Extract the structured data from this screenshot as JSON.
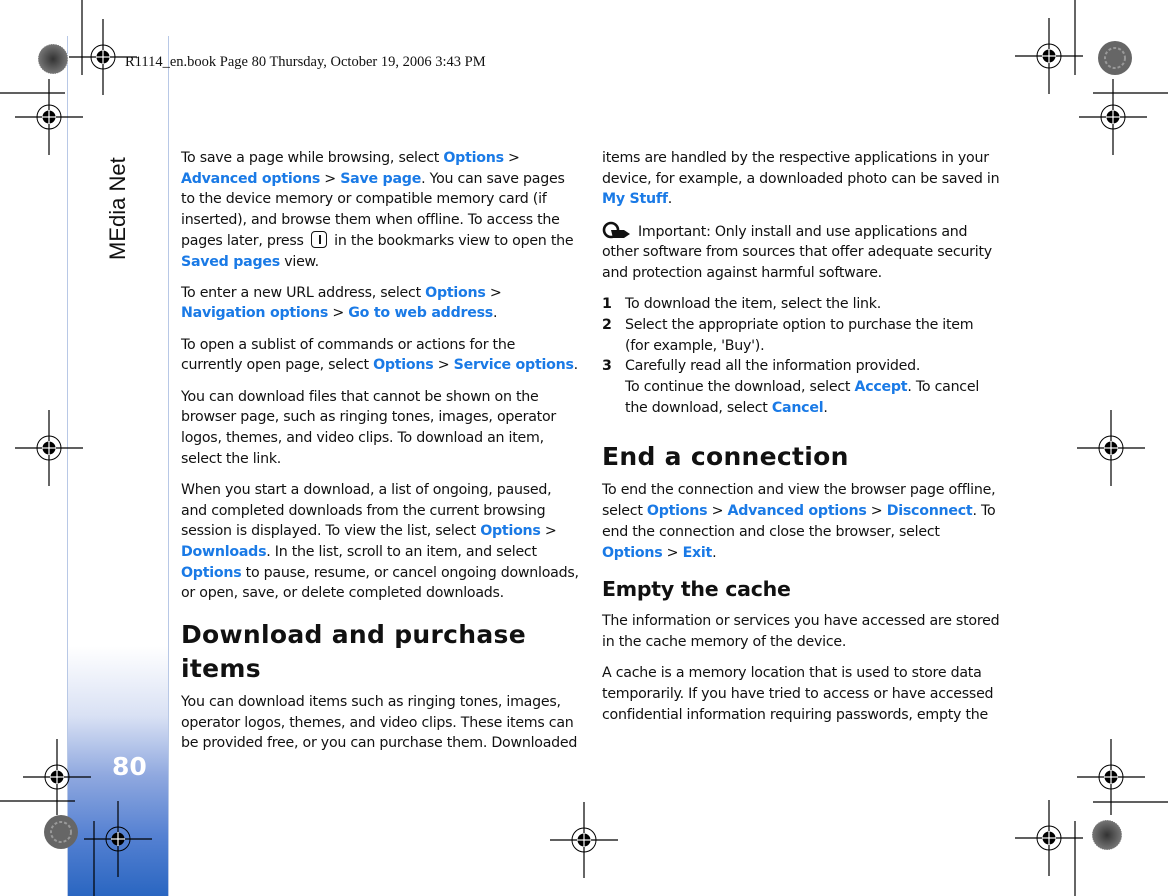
{
  "header": {
    "print_info": "R1114_en.book  Page 80  Thursday, October 19, 2006  3:43 PM"
  },
  "side_tab": {
    "section_title": "MEdia Net",
    "page_number": "80",
    "gradient_color": "#2a66c1"
  },
  "colors": {
    "link": "#1a7ae6",
    "text": "#111111"
  },
  "left_column": {
    "p1": {
      "t1": "To save a page while browsing, select ",
      "l1": "Options",
      "t2": " > ",
      "l2": "Advanced options",
      "t3": " > ",
      "l3": "Save page",
      "t4": ". You can save pages to the device memory or compatible memory card (if inserted), and browse them when offline. To access the pages later, press ",
      "key_icon": "scroll-key-icon",
      "t5": " in the bookmarks view to open the ",
      "l4": "Saved pages",
      "t6": " view."
    },
    "p2": {
      "t1": "To enter a new URL address, select ",
      "l1": "Options",
      "t2": " > ",
      "l2": "Navigation options",
      "t3": " > ",
      "l3": "Go to web address",
      "t4": "."
    },
    "p3": {
      "t1": "To open a sublist of commands or actions for the currently open page, select ",
      "l1": "Options",
      "t2": " > ",
      "l2": "Service options",
      "t3": "."
    },
    "p4": "You can download files that cannot be shown on the browser page, such as ringing tones, images, operator logos, themes, and video clips. To download an item, select the link.",
    "p5": {
      "t1": "When you start a download, a list of ongoing, paused, and completed downloads from the current browsing session is displayed. To view the list, select ",
      "l1": "Options",
      "t2": " > ",
      "l2": "Downloads",
      "t3": ". In the list, scroll to an item, and select ",
      "l3": "Options",
      "t4": " to pause, resume, or cancel ongoing downloads, or open, save, or delete completed downloads."
    },
    "h_download": "Download and purchase items",
    "p6": "You can download items such as ringing tones, images, operator logos, themes, and video clips. These items can be provided free, or you can purchase them. Downloaded"
  },
  "right_column": {
    "p1": {
      "t1": "items are handled by the respective applications in your device, for example, a downloaded photo can be saved in ",
      "l1": "My Stuff",
      "t2": "."
    },
    "important": {
      "icon": "warning-hand-icon",
      "text": "Important: Only install and use applications and other software from sources that offer adequate security and protection against harmful software."
    },
    "steps": [
      {
        "num": "1",
        "text": "To download the item, select the link."
      },
      {
        "num": "2",
        "text": "Select the appropriate option to purchase the item (for example, 'Buy')."
      },
      {
        "num": "3",
        "text": "Carefully read all the information provided.",
        "t1": "To continue the download, select ",
        "l1": "Accept",
        "t2": ". To cancel the download, select ",
        "l2": "Cancel",
        "t3": "."
      }
    ],
    "h_end": "End a connection",
    "p2": {
      "t1": "To end the connection and view the browser page offline, select ",
      "l1": "Options",
      "t2": " > ",
      "l2": "Advanced options",
      "t3": " > ",
      "l3": "Disconnect",
      "t4": ". To end the connection and close the browser, select ",
      "l4": "Options",
      "t5": " > ",
      "l5": "Exit",
      "t6": "."
    },
    "h_cache": "Empty the cache",
    "p3": "The information or services you have accessed are stored in the cache memory of the device.",
    "p4": "A cache is a memory location that is used to store data temporarily. If you have tried to access or have accessed confidential information requiring passwords, empty the"
  }
}
